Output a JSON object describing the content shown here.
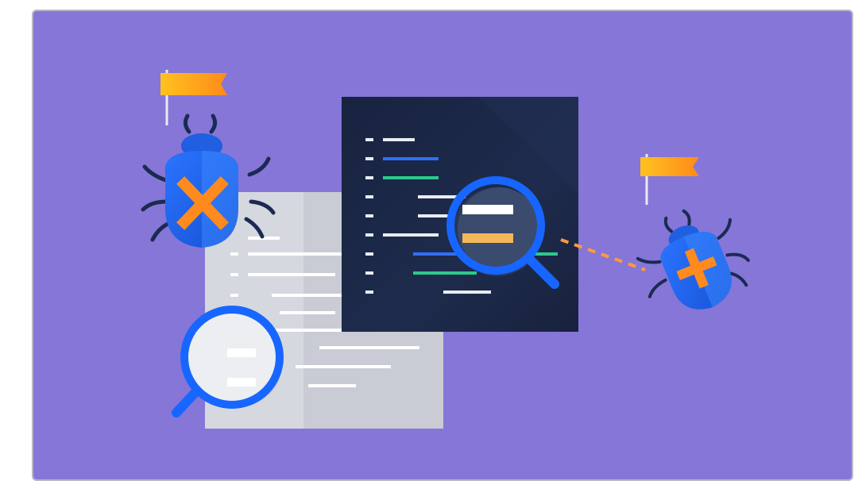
{
  "illustration": {
    "subject": "bug-tracking-illustration",
    "icons": [
      "flag-icon",
      "bug-icon",
      "bug-icon",
      "magnifier-icon",
      "magnifier-icon",
      "code-document-icon",
      "text-document-icon"
    ],
    "colors": {
      "background": "#8576d8",
      "dark_panel": "#1c2744",
      "light_document": "#d8dbe2",
      "bug_blue": "#1f63e6",
      "bug_blue_light": "#3a86ff",
      "accent_orange": "#ff8b1f",
      "flag_yellow": "#ffb21a",
      "magnifier_blue": "#1766ff",
      "code_green": "#2ec98b",
      "code_blue": "#2f6ff7",
      "code_white": "#e8ecf3",
      "code_yellow": "#f3b85a"
    }
  }
}
